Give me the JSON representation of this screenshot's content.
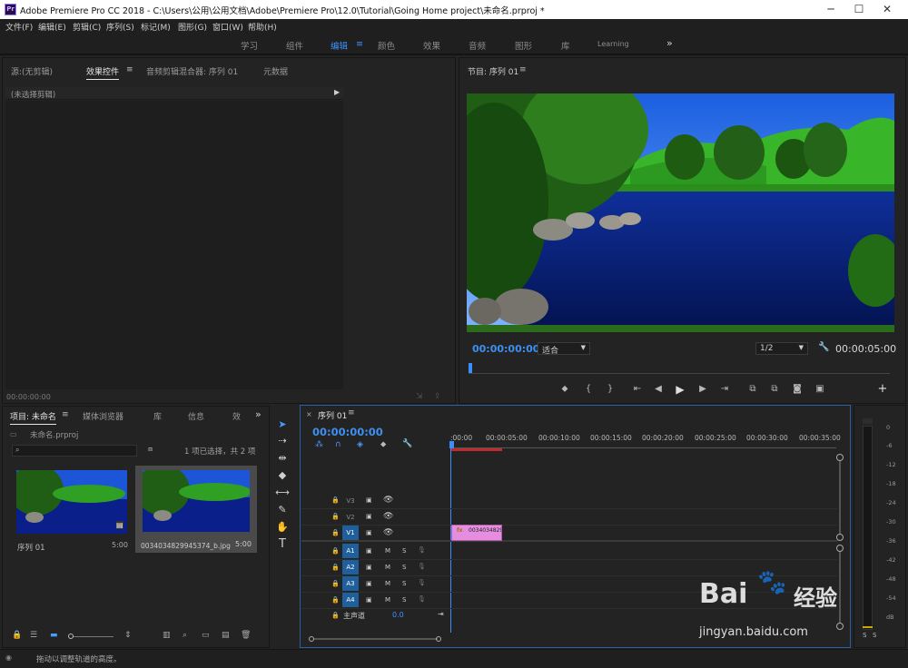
{
  "window": {
    "title": "Adobe Premiere Pro CC 2018 - C:\\Users\\公用\\公用文档\\Adobe\\Premiere Pro\\12.0\\Tutorial\\Going Home project\\未命名.prproj *",
    "icon_text": "Pr"
  },
  "menu": [
    "文件(F)",
    "编辑(E)",
    "剪辑(C)",
    "序列(S)",
    "标记(M)",
    "图形(G)",
    "窗口(W)",
    "帮助(H)"
  ],
  "workspaces": {
    "items": [
      "学习",
      "组件",
      "编辑",
      "颜色",
      "效果",
      "音频",
      "图形",
      "库",
      "Learning"
    ],
    "active": "编辑",
    "more": "»"
  },
  "source_panel": {
    "tabs": [
      "源:(无剪辑)",
      "效果控件",
      "音频剪辑混合器: 序列 01",
      "元数据"
    ],
    "active_tab": "效果控件",
    "no_clip_text": "(未选择剪辑)",
    "timecode": "00:00:00:00"
  },
  "program_monitor": {
    "title": "节目: 序列 01",
    "timecode": "00:00:00:00",
    "fit": "适合",
    "resolution": "1/2",
    "duration": "00:00:05:00"
  },
  "project_panel": {
    "tabs": [
      "项目: 未命名",
      "媒体浏览器",
      "库",
      "信息",
      "效"
    ],
    "file": "未命名.prproj",
    "selection_info": "1 项已选择，共 2 项",
    "items": [
      {
        "name": "序列 01",
        "duration": "5:00"
      },
      {
        "name": "0034034829945374_b.jpg",
        "duration": "5:00"
      }
    ]
  },
  "timeline": {
    "tab": "序列 01",
    "timecode": "00:00:00:00",
    "ruler": [
      ":00:00",
      "00:00:05:00",
      "00:00:10:00",
      "00:00:15:00",
      "00:00:20:00",
      "00:00:25:00",
      "00:00:30:00",
      "00:00:35:00"
    ],
    "video_tracks": [
      "V3",
      "V2",
      "V1"
    ],
    "audio_tracks": [
      "A1",
      "A2",
      "A3",
      "A4"
    ],
    "master_label": "主声道",
    "master_value": "0.0",
    "clip_label": "00340348299",
    "clip_fx": "fx"
  },
  "meters": {
    "labels": [
      "0",
      "-6",
      "-12",
      "-18",
      "-24",
      "-30",
      "-36",
      "-42",
      "-48",
      "-54",
      "dB"
    ],
    "solo": [
      "S",
      "S"
    ]
  },
  "status_bar": {
    "text": "拖动以调整轨道的高度。"
  },
  "watermark": {
    "brand": "Bai",
    "brand2": "经验",
    "url": "jingyan.baidu.com"
  },
  "colors": {
    "accent": "#3c93ff",
    "clip": "#e58ee0",
    "track_active": "#1e5f9c"
  }
}
